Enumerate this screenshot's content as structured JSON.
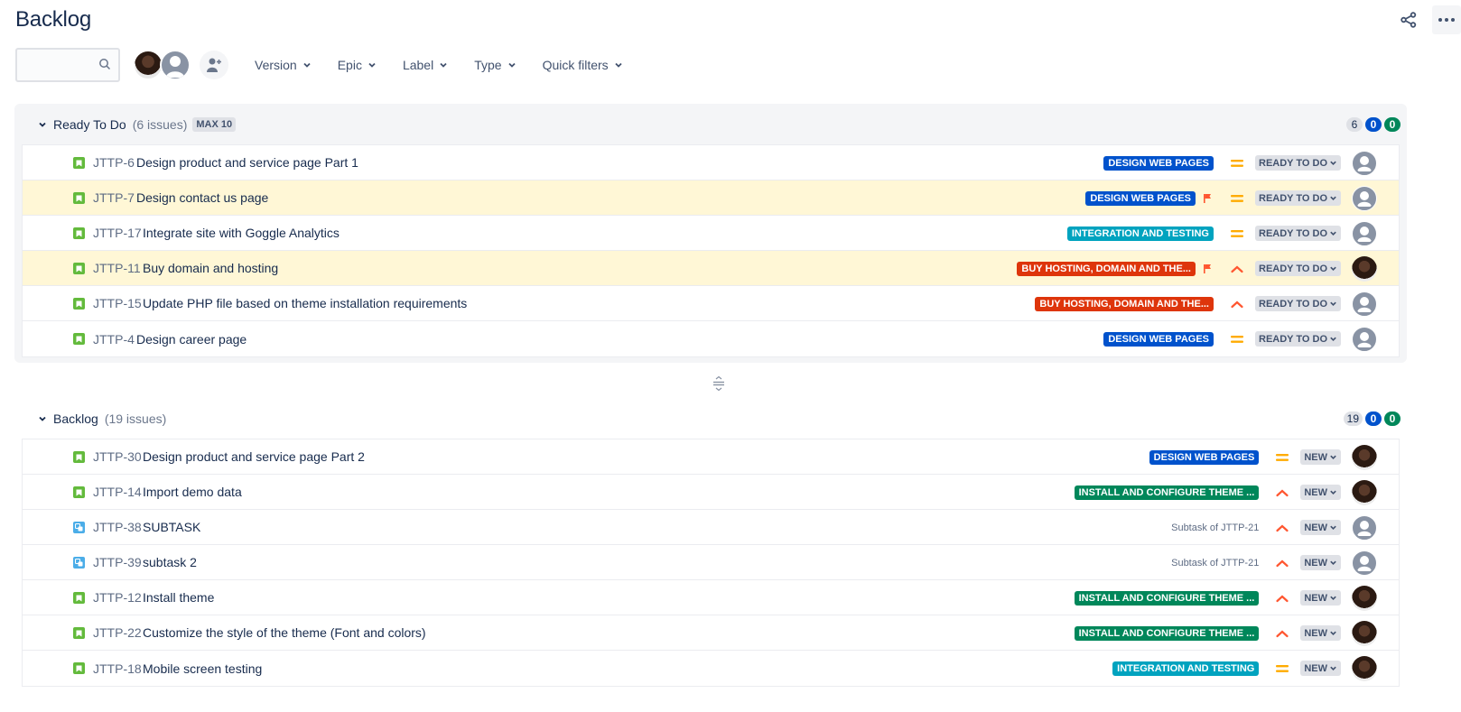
{
  "page": {
    "title": "Backlog"
  },
  "header": {
    "share_icon": "share-icon",
    "more_icon": "more-horizontal-icon"
  },
  "toolbar": {
    "search_placeholder": "",
    "search_value": "",
    "filters": [
      {
        "label": "Version"
      },
      {
        "label": "Epic"
      },
      {
        "label": "Label"
      },
      {
        "label": "Type"
      },
      {
        "label": "Quick filters"
      }
    ]
  },
  "colors": {
    "epic_design": "#0052cc",
    "epic_integration": "#00a3bf",
    "epic_hosting": "#de350b",
    "epic_install": "#00875a",
    "priority_medium": "#ffab00",
    "priority_high": "#ff5630",
    "flag": "#ff5630",
    "flagged_row": "#fff7d6"
  },
  "sprint": {
    "name": "Ready To Do",
    "count_label": "(6 issues)",
    "max_label": "MAX 10",
    "counters": {
      "todo": "6",
      "in_progress": "0",
      "done": "0"
    },
    "issues": [
      {
        "key": "JTTP-6",
        "summary": "Design product and service page Part 1",
        "type": "story",
        "epic": "DESIGN WEB PAGES",
        "epic_color": "#0052cc",
        "flagged": false,
        "priority": "medium",
        "status": "READY TO DO",
        "assignee": "unassigned"
      },
      {
        "key": "JTTP-7",
        "summary": "Design contact us page",
        "type": "story",
        "epic": "DESIGN WEB PAGES",
        "epic_color": "#0052cc",
        "flagged": true,
        "priority": "medium",
        "status": "READY TO DO",
        "assignee": "unassigned"
      },
      {
        "key": "JTTP-17",
        "summary": "Integrate site with Goggle Analytics",
        "type": "story",
        "epic": "INTEGRATION AND TESTING",
        "epic_color": "#00a3bf",
        "flagged": false,
        "priority": "medium",
        "status": "READY TO DO",
        "assignee": "unassigned"
      },
      {
        "key": "JTTP-11",
        "summary": "Buy domain and hosting",
        "type": "story",
        "epic": "BUY HOSTING, DOMAIN AND THE...",
        "epic_color": "#de350b",
        "flagged": true,
        "priority": "high",
        "status": "READY TO DO",
        "assignee": "user"
      },
      {
        "key": "JTTP-15",
        "summary": "Update PHP file based on theme installation requirements",
        "type": "story",
        "epic": "BUY HOSTING, DOMAIN AND THE...",
        "epic_color": "#de350b",
        "flagged": false,
        "priority": "high",
        "status": "READY TO DO",
        "assignee": "unassigned"
      },
      {
        "key": "JTTP-4",
        "summary": "Design career page",
        "type": "story",
        "epic": "DESIGN WEB PAGES",
        "epic_color": "#0052cc",
        "flagged": false,
        "priority": "medium",
        "status": "READY TO DO",
        "assignee": "unassigned"
      }
    ]
  },
  "backlog": {
    "name": "Backlog",
    "count_label": "(19 issues)",
    "counters": {
      "todo": "19",
      "in_progress": "0",
      "done": "0"
    },
    "issues": [
      {
        "key": "JTTP-30",
        "summary": "Design product and service page Part 2",
        "type": "story",
        "epic": "DESIGN WEB PAGES",
        "epic_color": "#0052cc",
        "priority": "medium",
        "status": "NEW",
        "assignee": "user"
      },
      {
        "key": "JTTP-14",
        "summary": "Import demo data",
        "type": "story",
        "epic": "INSTALL AND CONFIGURE THEME ...",
        "epic_color": "#00875a",
        "priority": "high",
        "status": "NEW",
        "assignee": "user"
      },
      {
        "key": "JTTP-38",
        "summary": "SUBTASK",
        "type": "subtask",
        "parent": "Subtask of JTTP-21",
        "priority": "high",
        "status": "NEW",
        "assignee": "unassigned"
      },
      {
        "key": "JTTP-39",
        "summary": "subtask 2",
        "type": "subtask",
        "parent": "Subtask of JTTP-21",
        "priority": "high",
        "status": "NEW",
        "assignee": "unassigned"
      },
      {
        "key": "JTTP-12",
        "summary": "Install theme",
        "type": "story",
        "epic": "INSTALL AND CONFIGURE THEME ...",
        "epic_color": "#00875a",
        "priority": "high",
        "status": "NEW",
        "assignee": "user"
      },
      {
        "key": "JTTP-22",
        "summary": "Customize the style of the theme (Font and colors)",
        "type": "story",
        "epic": "INSTALL AND CONFIGURE THEME ...",
        "epic_color": "#00875a",
        "priority": "high",
        "status": "NEW",
        "assignee": "user"
      },
      {
        "key": "JTTP-18",
        "summary": "Mobile screen testing",
        "type": "story",
        "epic": "INTEGRATION AND TESTING",
        "epic_color": "#00a3bf",
        "priority": "medium",
        "status": "NEW",
        "assignee": "user"
      }
    ]
  }
}
